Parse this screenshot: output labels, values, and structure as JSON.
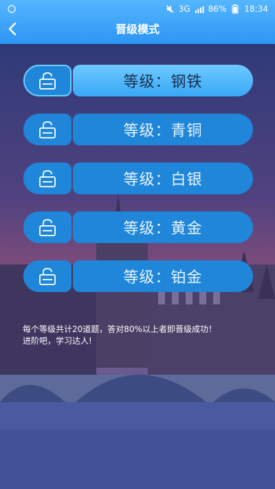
{
  "status": {
    "network": "3G",
    "battery": "86%",
    "time": "18:34"
  },
  "header": {
    "title": "晋级模式"
  },
  "levels": [
    {
      "label": "等级：钢铁",
      "locked": true,
      "active": true
    },
    {
      "label": "等级：青铜",
      "locked": true,
      "active": false
    },
    {
      "label": "等级：白银",
      "locked": true,
      "active": false
    },
    {
      "label": "等级：黄金",
      "locked": true,
      "active": false
    },
    {
      "label": "等级：铂金",
      "locked": true,
      "active": false
    }
  ],
  "note": {
    "line1": "每个等级共计20道题，答对80%以上者即晋级成功！",
    "line2": "进阶吧，学习达人!"
  },
  "colors": {
    "header_blue": "#2d95f4",
    "pill_blue": "#1f86d9",
    "active_pill": "#39a8f6"
  },
  "icons": {
    "back": "chevron-left-icon",
    "lock": "lock-open-icon"
  }
}
